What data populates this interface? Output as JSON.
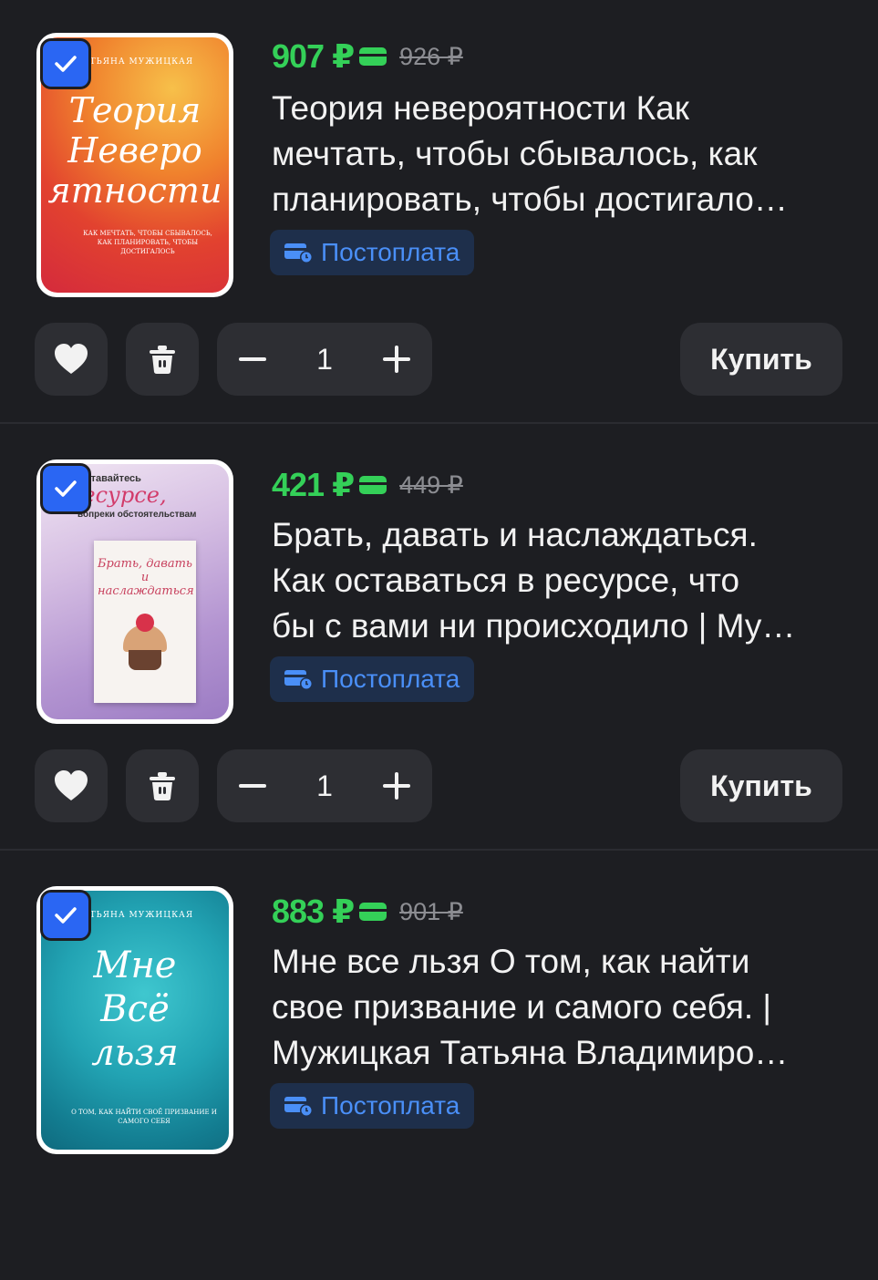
{
  "items": [
    {
      "price": "907 ₽",
      "old_price": "926 ₽",
      "title": "Теория невероятности  Как\nмечтать, чтобы сбывалось, как\nпланировать, чтобы достигало…",
      "badge": "Постоплата",
      "quantity": "1",
      "buy_label": "Купить",
      "cover": {
        "author": "ТАТЬЯНА МУЖИЦКАЯ",
        "title": "Теория\nНевеpо\nятности",
        "subtitle": "КАК МЕЧТАТЬ, ЧТОБЫ СБЫВАЛОСЬ, КАК ПЛАНИРОВАТЬ, ЧТОБЫ ДОСТИГАЛОСЬ",
        "colors": [
          "#f5a623",
          "#e8452c",
          "#d8233a"
        ]
      },
      "checked": true
    },
    {
      "price": "421 ₽",
      "old_price": "449 ₽",
      "title": "Брать, давать и наслаждаться.\nКак оставаться в ресурсе, что\nбы с вами ни происходило | Му…",
      "badge": "Постоплата",
      "quantity": "1",
      "buy_label": "Купить",
      "cover": {
        "author": "Оставайтесь",
        "title": "ресурсе,",
        "subtitle": "вопреки обстоятельствам",
        "book_title": "Брать, давать и наслаждаться",
        "colors": [
          "#e7d9ee",
          "#a77fc4",
          "#8a6bb8"
        ]
      },
      "checked": true
    },
    {
      "price": "883 ₽",
      "old_price": "901 ₽",
      "title": "Мне все льзя  О том, как найти\nсвое призвание и самого себя. |\nМужицкая Татьяна Владимиро…",
      "badge": "Постоплата",
      "quantity": "1",
      "buy_label": "Купить",
      "cover": {
        "author": "ТАТЬЯНА МУЖИЦКАЯ",
        "title": "Мне\nВсё\nльзя",
        "subtitle": "О ТОМ, КАК НАЙТИ СВОЁ ПРИЗВАНИЕ И САМОГО СЕБЯ",
        "colors": [
          "#2fb6c4",
          "#1a8ea0",
          "#0f6f83"
        ]
      },
      "checked": true
    }
  ],
  "colors": {
    "background": "#1d1e22",
    "price": "#34d058",
    "accent": "#2a66f3",
    "badge_text": "#4a8ff7",
    "button": "#2d2e33"
  },
  "icons": {
    "checkbox": "check-icon",
    "like": "heart-icon",
    "trash": "trash-icon",
    "minus": "minus-icon",
    "plus": "plus-icon",
    "badge": "card-clock-icon"
  }
}
